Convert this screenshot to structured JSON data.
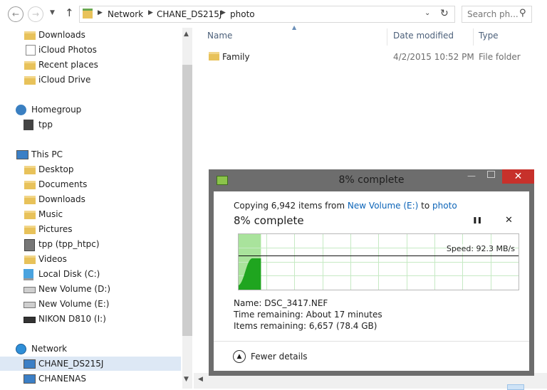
{
  "address": {
    "crumbs": [
      "Network",
      "CHANE_DS215J",
      "photo"
    ],
    "search_placeholder": "Search ph..."
  },
  "nav": {
    "items": [
      {
        "label": "Downloads",
        "icon": "folder-download-icon"
      },
      {
        "label": "iCloud Photos",
        "icon": "document-icon"
      },
      {
        "label": "Recent places",
        "icon": "folder-icon"
      },
      {
        "label": "iCloud Drive",
        "icon": "folder-icon"
      },
      {
        "label": "Homegroup",
        "icon": "homegroup-icon"
      },
      {
        "label": "tpp",
        "icon": "user-icon"
      },
      {
        "label": "This PC",
        "icon": "computer-icon"
      },
      {
        "label": "Desktop",
        "icon": "folder-icon"
      },
      {
        "label": "Documents",
        "icon": "folder-icon"
      },
      {
        "label": "Downloads",
        "icon": "folder-icon"
      },
      {
        "label": "Music",
        "icon": "folder-icon"
      },
      {
        "label": "Pictures",
        "icon": "folder-icon"
      },
      {
        "label": "tpp (tpp_htpc)",
        "icon": "network-drive-icon"
      },
      {
        "label": "Videos",
        "icon": "folder-icon"
      },
      {
        "label": "Local Disk (C:)",
        "icon": "windows-drive-icon"
      },
      {
        "label": "New Volume (D:)",
        "icon": "drive-icon"
      },
      {
        "label": "New Volume (E:)",
        "icon": "drive-icon"
      },
      {
        "label": "NIKON D810 (I:)",
        "icon": "camera-drive-icon"
      },
      {
        "label": "Network",
        "icon": "network-icon"
      },
      {
        "label": "CHANE_DS215J",
        "icon": "computer-icon"
      },
      {
        "label": "CHANENAS",
        "icon": "computer-icon"
      }
    ]
  },
  "files": {
    "columns": {
      "name": "Name",
      "date": "Date modified",
      "type": "Type"
    },
    "rows": [
      {
        "name": "Family",
        "date": "4/2/2015 10:52 PM",
        "type": "File folder"
      }
    ]
  },
  "dialog": {
    "title": "8% complete",
    "copy_prefix": "Copying 6,942 items from",
    "source": "New Volume (E:)",
    "to": "to",
    "destination": "photo",
    "heading": "8% complete",
    "progress_fraction": 0.08,
    "speed": "Speed: 92.3 MB/s",
    "name_label": "Name:",
    "name_value": "DSC_3417.NEF",
    "time_label": "Time remaining:",
    "time_value": "About 17 minutes",
    "items_label": "Items remaining:",
    "items_value": "6,657 (78.4 GB)",
    "fewer_details": "Fewer details",
    "close_symbol": "✕",
    "pause_symbol": "❚❚",
    "cancel_symbol": "✕",
    "accent": "#06b025"
  }
}
